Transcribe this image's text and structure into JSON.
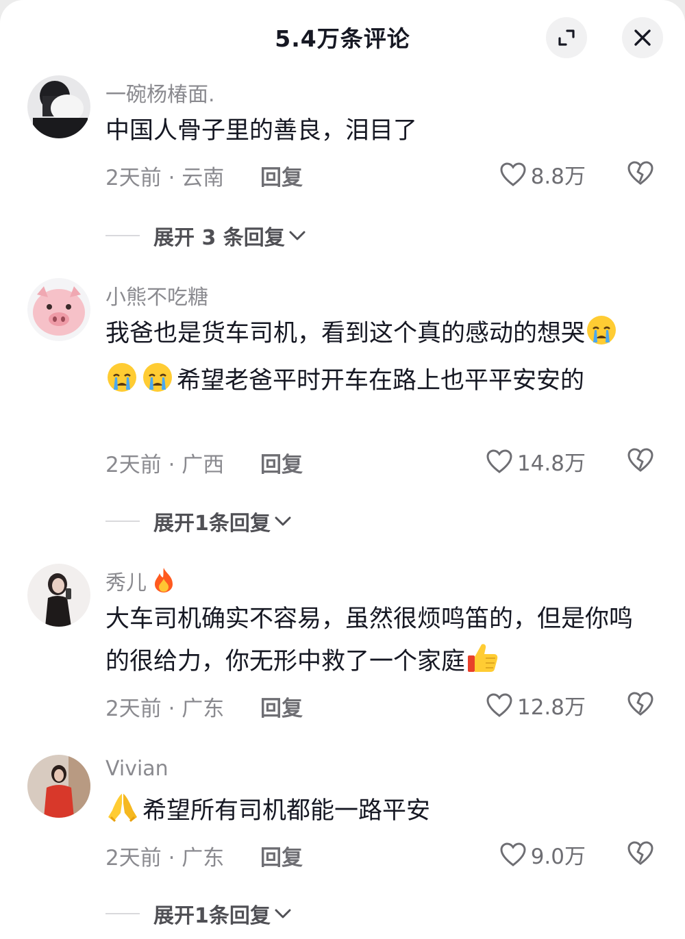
{
  "header": {
    "title": "5.4万条评论",
    "expand_icon": "expand-icon",
    "close_icon": "close-icon"
  },
  "comments": [
    {
      "username": "一碗杨椿面.",
      "text": "中国人骨子里的善良，泪目了",
      "time_location": "2天前 · 云南",
      "reply_label": "回复",
      "likes": "8.8万",
      "expand_label": "展开 3 条回复",
      "avatar": "avatar-person-dark"
    },
    {
      "username": "小熊不吃糖",
      "text_before": "我爸也是货车司机，看到这个真的感动的想哭",
      "emoji": [
        "crying-emoji",
        "crying-emoji",
        "crying-emoji"
      ],
      "text_after": "希望老爸平时开车在路上也平平安安的",
      "time_location": "2天前 · 广西",
      "reply_label": "回复",
      "likes": "14.8万",
      "expand_label": "展开1条回复",
      "avatar": "avatar-pig"
    },
    {
      "username": "秀儿",
      "username_emoji": "fire-emoji",
      "text": "大车司机确实不容易，虽然很烦鸣笛的，但是你鸣的很给力，你无形中救了一个家庭",
      "trailing_emoji": "thumbs-up-emoji",
      "time_location": "2天前 · 广东",
      "reply_label": "回复",
      "likes": "12.8万",
      "avatar": "avatar-girl-selfie"
    },
    {
      "username": "Vivian",
      "leading_emoji": "praying-hands-emoji",
      "text": "希望所有司机都能一路平安",
      "time_location": "2天前 · 广东",
      "reply_label": "回复",
      "likes": "9.0万",
      "expand_label": "展开1条回复",
      "avatar": "avatar-girl-red"
    }
  ],
  "colors": {
    "primary_text": "#161823",
    "secondary_text": "#8a8a8f",
    "background": "#ffffff"
  }
}
